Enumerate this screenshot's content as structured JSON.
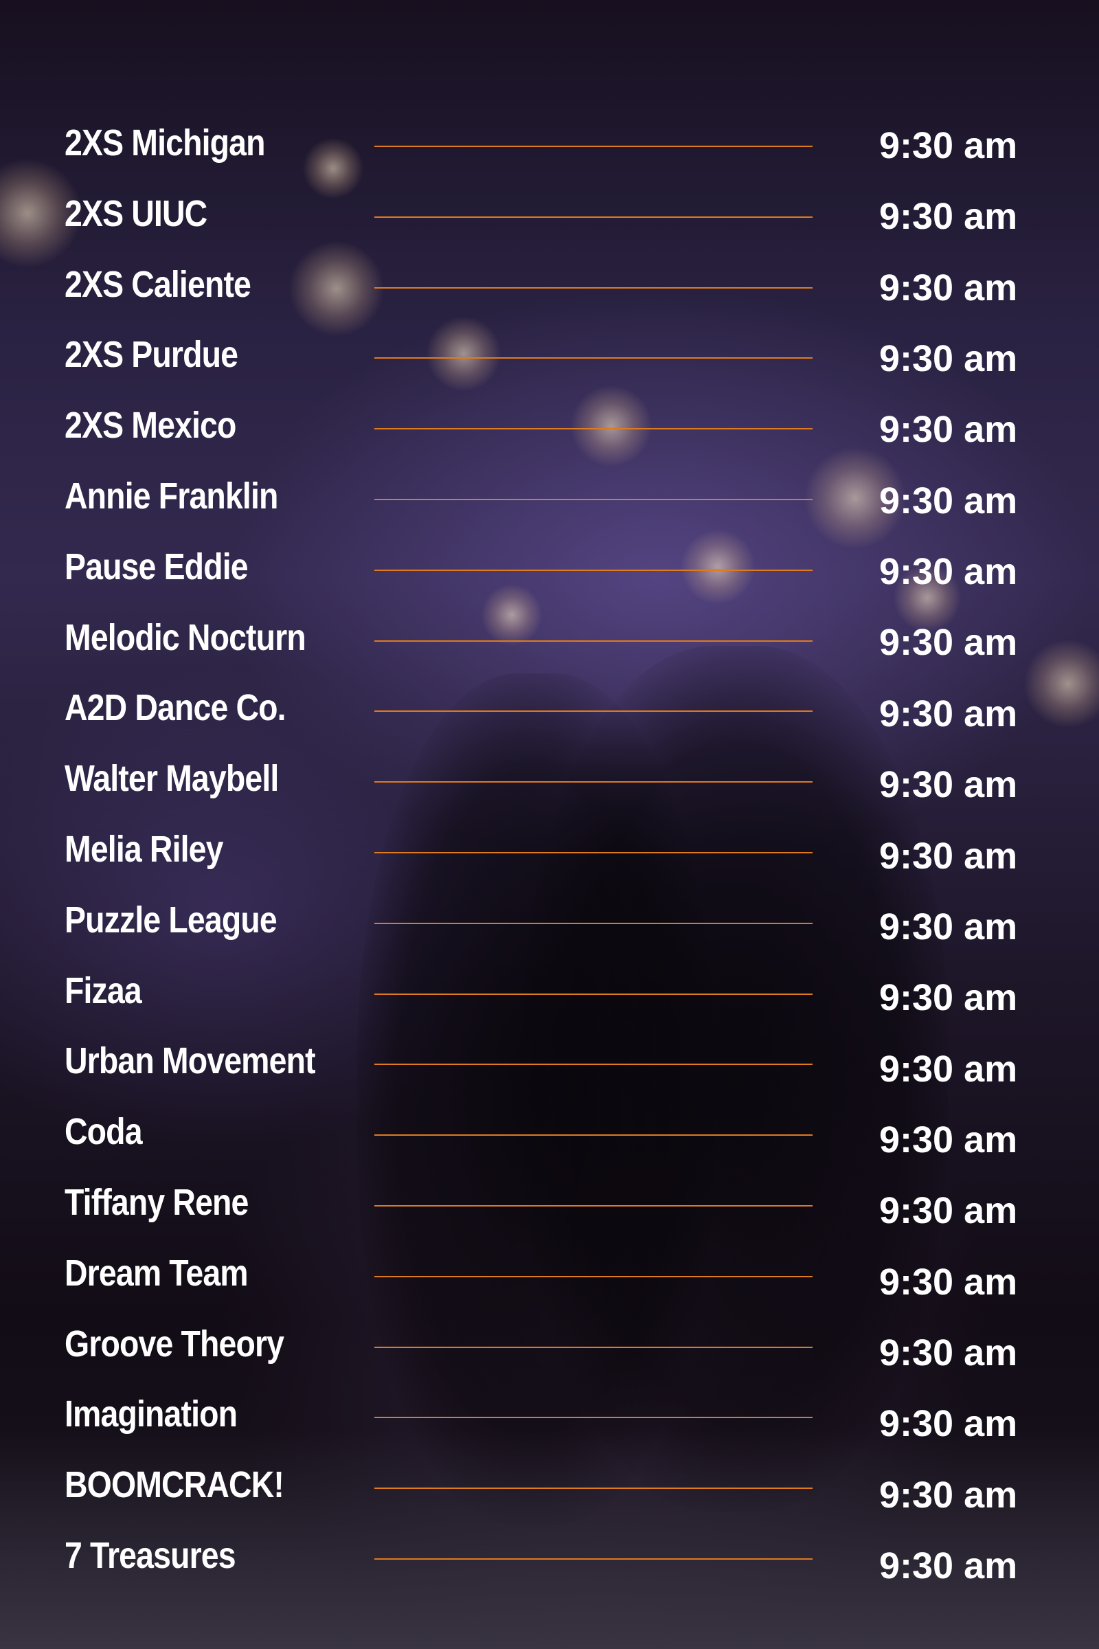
{
  "schedule": {
    "entries": [
      {
        "name": "2XS Michigan",
        "time": "9:30 am"
      },
      {
        "name": "2XS UIUC",
        "time": "9:30 am"
      },
      {
        "name": "2XS Caliente",
        "time": "9:30 am"
      },
      {
        "name": "2XS Purdue",
        "time": "9:30 am"
      },
      {
        "name": "2XS Mexico",
        "time": "9:30 am"
      },
      {
        "name": "Annie Franklin",
        "time": "9:30 am"
      },
      {
        "name": "Pause Eddie",
        "time": "9:30 am"
      },
      {
        "name": "Melodic Nocturn",
        "time": "9:30 am"
      },
      {
        "name": "A2D Dance Co.",
        "time": "9:30 am"
      },
      {
        "name": "Walter Maybell",
        "time": "9:30 am"
      },
      {
        "name": "Melia Riley",
        "time": "9:30 am"
      },
      {
        "name": "Puzzle League",
        "time": "9:30 am"
      },
      {
        "name": "Fizaa",
        "time": "9:30 am"
      },
      {
        "name": "Urban Movement",
        "time": "9:30 am"
      },
      {
        "name": "Coda",
        "time": "9:30 am"
      },
      {
        "name": "Tiffany Rene",
        "time": "9:30 am"
      },
      {
        "name": "Dream Team",
        "time": "9:30 am"
      },
      {
        "name": "Groove Theory",
        "time": "9:30 am"
      },
      {
        "name": "Imagination",
        "time": "9:30 am"
      },
      {
        "name": "BOOMCRACK!",
        "time": "9:30 am"
      },
      {
        "name": "7 Treasures",
        "time": "9:30 am"
      }
    ]
  },
  "colors": {
    "text": "#ffffff",
    "leader_line": "#e07a1f",
    "background": "#1d1628"
  },
  "background_image": {
    "icon": "dancers-on-stage-photo"
  }
}
